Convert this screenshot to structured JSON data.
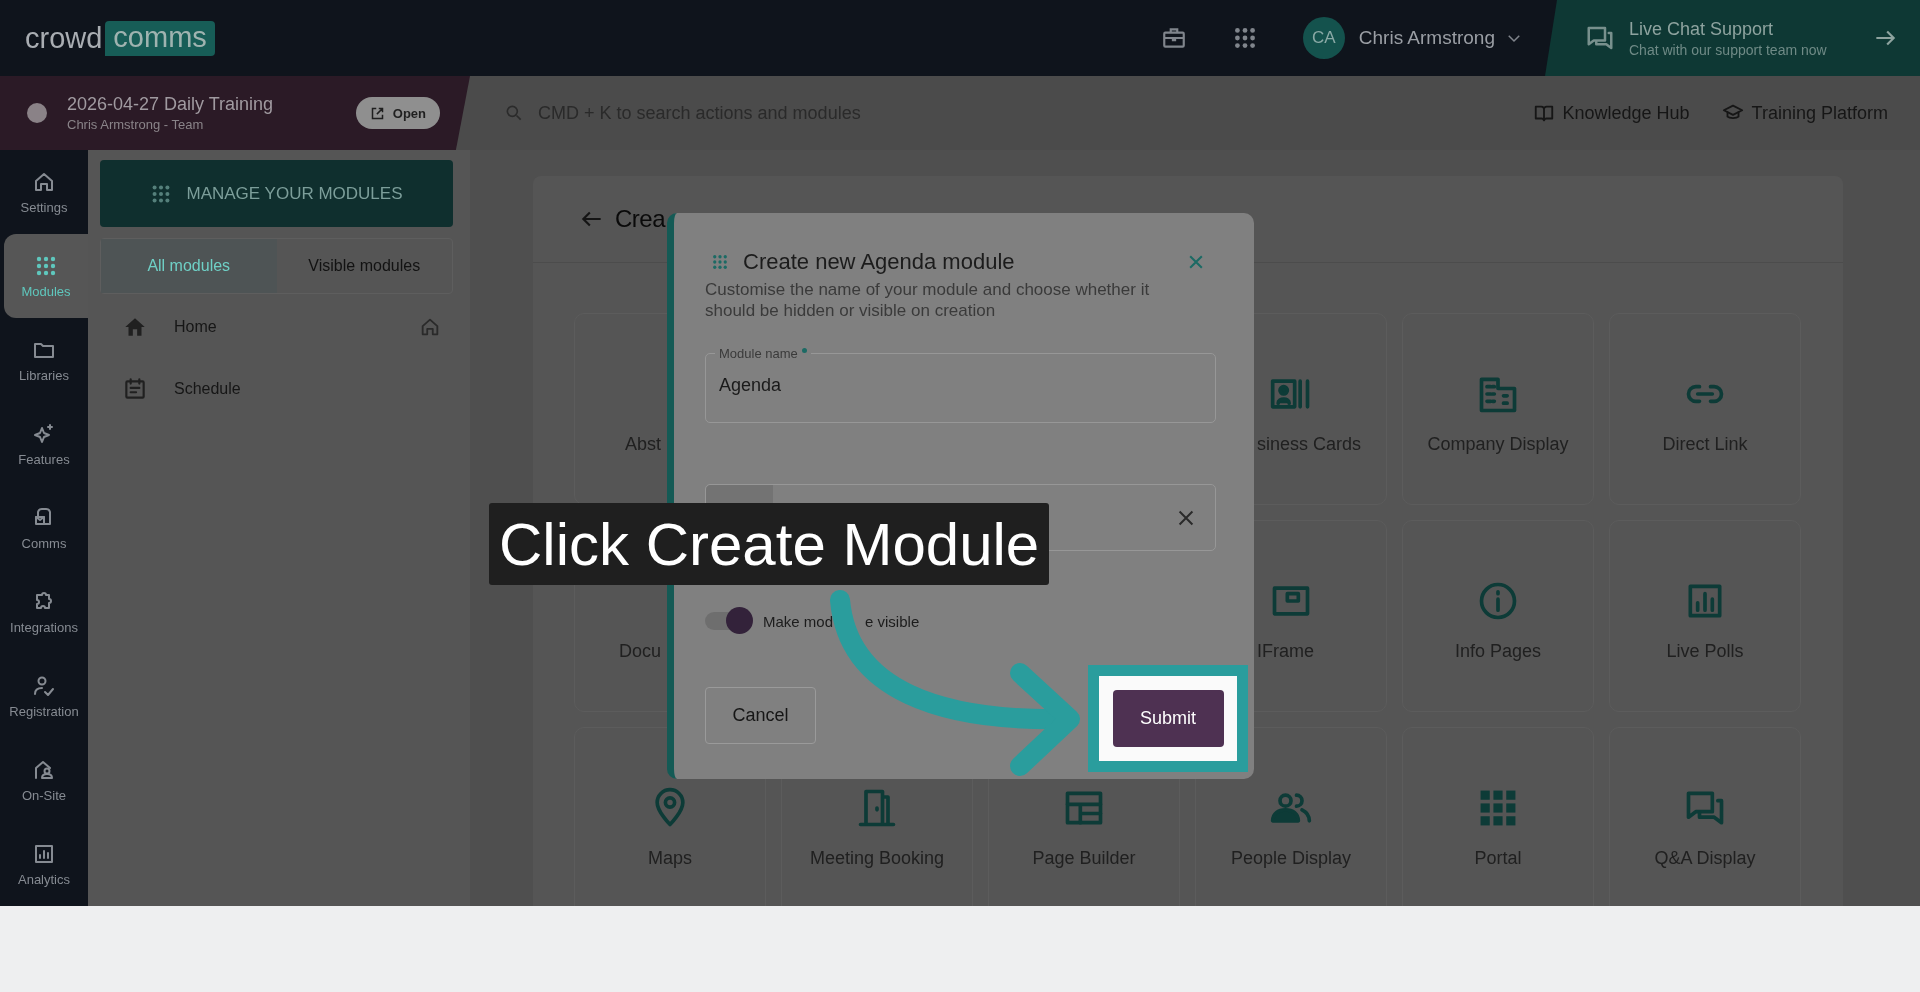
{
  "topbar": {
    "logo": [
      "crowd",
      "comms"
    ],
    "user": {
      "initials": "CA",
      "name": "Chris Armstrong"
    },
    "live_chat": {
      "title": "Live Chat Support",
      "subtitle": "Chat with our support team now"
    }
  },
  "event": {
    "title": "2026-04-27 Daily Training",
    "subtitle": "Chris Armstrong - Team",
    "button": "Open"
  },
  "search": {
    "placeholder": "CMD + K to search actions and modules"
  },
  "links": [
    {
      "label": "Knowledge Hub",
      "kind": "book"
    },
    {
      "label": "Training Platform",
      "kind": "cap"
    }
  ],
  "rail": [
    {
      "label": "Settings",
      "kind": "home",
      "selected": false
    },
    {
      "label": "Modules",
      "kind": "dots",
      "selected": true
    },
    {
      "label": "Libraries",
      "kind": "folder",
      "selected": false
    },
    {
      "label": "Features",
      "kind": "sparkle",
      "selected": false
    },
    {
      "label": "Comms",
      "kind": "mail",
      "selected": false
    },
    {
      "label": "Integrations",
      "kind": "puzzle",
      "selected": false
    },
    {
      "label": "Registration",
      "kind": "usercheck",
      "selected": false
    },
    {
      "label": "On-Site",
      "kind": "onsite",
      "selected": false
    },
    {
      "label": "Analytics",
      "kind": "chart",
      "selected": false
    }
  ],
  "modules_panel": {
    "manage_button": "MANAGE YOUR MODULES",
    "tabs": [
      {
        "label": "All modules",
        "selected": true
      },
      {
        "label": "Visible modules",
        "selected": false
      }
    ],
    "items": [
      {
        "label": "Home",
        "kind": "home",
        "home": true
      },
      {
        "label": "Schedule",
        "kind": "schedule",
        "home": false
      }
    ]
  },
  "page": {
    "title": "Crea",
    "rows": [
      {
        "left": [
          {
            "label": "Abst"
          }
        ],
        "right": [
          {
            "label": "siness Cards",
            "kind": "idcard"
          },
          {
            "label": "Company Display",
            "kind": "building"
          },
          {
            "label": "Direct Link",
            "kind": "link"
          }
        ]
      },
      {
        "left": [
          {
            "label": "Docu"
          }
        ],
        "right": [
          {
            "label": "IFrame",
            "kind": "iframe"
          },
          {
            "label": "Info Pages",
            "kind": "info"
          },
          {
            "label": "Live Polls",
            "kind": "polls"
          }
        ]
      },
      {
        "left": [
          {
            "label": "Maps",
            "kind": "pin"
          },
          {
            "label": "Meeting Booking",
            "kind": "door"
          },
          {
            "label": "Page Builder",
            "kind": "layout"
          },
          {
            "label": "People Display",
            "kind": "people"
          },
          {
            "label": "Portal",
            "kind": "grid"
          },
          {
            "label": "Q&A Display",
            "kind": "chat"
          }
        ]
      }
    ]
  },
  "modal": {
    "title": "Create new Agenda module",
    "description": "Customise the name of your module and choose whether it should be hidden or visible on creation",
    "name_field": {
      "label": "Module name",
      "required": true,
      "value": "Agenda"
    },
    "toggle": {
      "label": [
        "Make mod",
        "e visible"
      ],
      "on": true
    },
    "cancel": "Cancel",
    "submit": "Submit"
  },
  "caption": "Click Create Module"
}
